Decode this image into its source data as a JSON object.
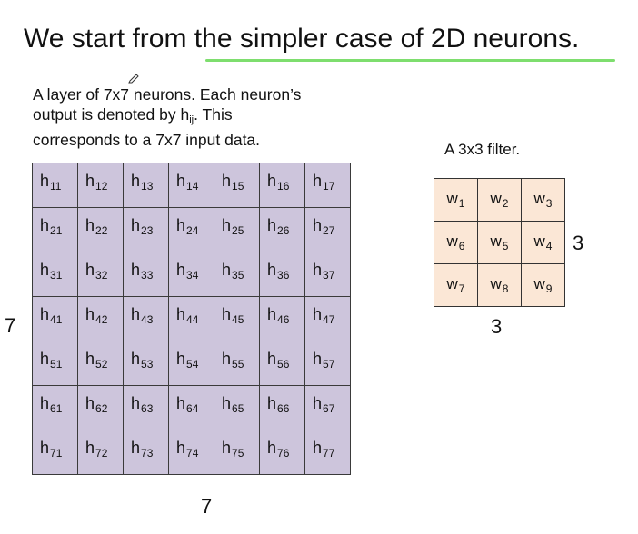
{
  "title": "We start from the simpler case of 2D neurons.",
  "description": {
    "line1": "A layer of 7x7 neurons. Each neuron’s",
    "line2_prefix": "output is denoted by h",
    "line2_sub": "ij",
    "line2_suffix": ". This",
    "line3": "corresponds to a 7x7 input data."
  },
  "neuron_grid": {
    "rows": 7,
    "cols": 7,
    "symbol": "h",
    "rows_label": "7",
    "cols_label": "7",
    "subscripts": [
      [
        "11",
        "12",
        "13",
        "14",
        "15",
        "16",
        "17"
      ],
      [
        "21",
        "22",
        "23",
        "24",
        "25",
        "26",
        "27"
      ],
      [
        "31",
        "32",
        "33",
        "34",
        "35",
        "36",
        "37"
      ],
      [
        "41",
        "42",
        "43",
        "44",
        "45",
        "46",
        "47"
      ],
      [
        "51",
        "52",
        "53",
        "54",
        "55",
        "56",
        "57"
      ],
      [
        "61",
        "62",
        "63",
        "64",
        "65",
        "66",
        "67"
      ],
      [
        "71",
        "72",
        "73",
        "74",
        "75",
        "76",
        "77"
      ]
    ]
  },
  "filter": {
    "label": "A 3x3 filter.",
    "symbol": "w",
    "rows_label": "3",
    "cols_label": "3",
    "subscripts": [
      [
        "1",
        "2",
        "3"
      ],
      [
        "6",
        "5",
        "4"
      ],
      [
        "7",
        "8",
        "9"
      ]
    ]
  },
  "colors": {
    "neuron_cell": "#cdc5dc",
    "filter_cell": "#fbe7d6",
    "underline": "#7ede6e"
  }
}
